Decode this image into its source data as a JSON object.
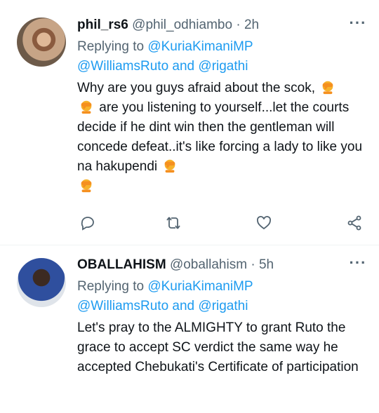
{
  "tweets": [
    {
      "name": "phil_rs6",
      "handle": "@phil_odhiambo",
      "separator": "·",
      "time": "2h",
      "replying_prefix": "Replying to",
      "mention1": "@KuriaKimaniMP",
      "mention2": "@WilliamsRuto",
      "and_word": "and",
      "mention3": "@rigathi",
      "text_parts": [
        "Why are you guys afraid about the scok,",
        "are you listening to yourself...let the courts decide if he dint win then the gentleman will concede defeat..it's like forcing a lady to like you na hakupendi"
      ],
      "emoji_icon": "facepalm-emoji-icon",
      "actions": [
        "reply-icon",
        "retweet-icon",
        "like-icon",
        "share-icon"
      ]
    },
    {
      "name": "OBALLAHISM",
      "handle": "@oballahism",
      "separator": "·",
      "time": "5h",
      "replying_prefix": "Replying to",
      "mention1": "@KuriaKimaniMP",
      "mention2": "@WilliamsRuto",
      "and_word": "and",
      "mention3": "@rigathi",
      "text": "Let's pray to the ALMIGHTY to grant Ruto the grace to accept SC verdict the same way he accepted Chebukati's Certificate of participation"
    }
  ],
  "more_icon": "more-options-icon",
  "colors": {
    "accent": "#1d9bf0",
    "secondary": "#536471",
    "text": "#0f1419",
    "divider": "#eff3f4"
  }
}
